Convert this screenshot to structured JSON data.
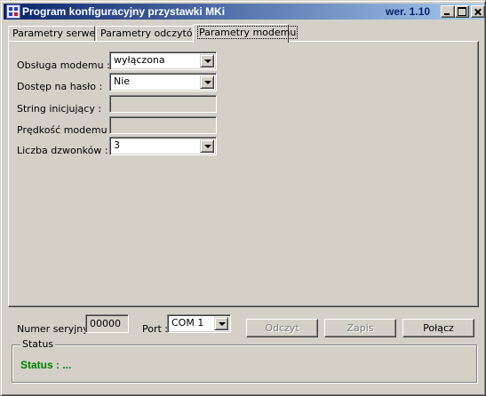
{
  "window": {
    "title": "Program konfiguracyjny przystawki MKi",
    "version": "wer. 1.10"
  },
  "tabs": [
    {
      "label": "Parametry serwera"
    },
    {
      "label": "Parametry odczytów"
    },
    {
      "label": "Parametry modemu",
      "active": true
    }
  ],
  "modem": {
    "obsluga_label": "Obsługa modemu :",
    "obsluga_value": "wyłączona",
    "dostep_label": "Dostęp na hasło :",
    "dostep_value": "Nie",
    "string_label": "String inicjujący :",
    "string_value": "",
    "predkosc_label": "Prędkość modemu :",
    "predkosc_value": "",
    "dzwonki_label": "Liczba dzwonków :",
    "dzwonki_value": "3"
  },
  "bottom": {
    "serial_label": "Numer seryjny :",
    "serial_value": "00000",
    "port_label": "Port :",
    "port_value": "COM 1",
    "read_button": "Odczyt",
    "write_button": "Zapis",
    "connect_button": "Połącz"
  },
  "status": {
    "group_label": "Status",
    "text": "Status : ...",
    "text_color": "#008000"
  }
}
